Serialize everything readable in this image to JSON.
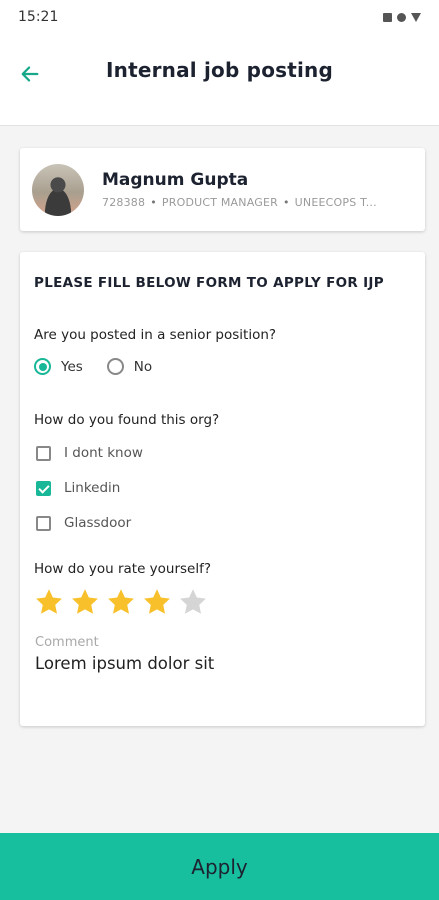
{
  "status_bar": {
    "time": "15:21"
  },
  "header": {
    "title": "Internal job posting",
    "back_icon": "arrow-left-icon"
  },
  "profile": {
    "name": "Magnum Gupta",
    "employee_id": "728388",
    "role": "PRODUCT MANAGER",
    "company": "UNEECOPS T..."
  },
  "form": {
    "heading": "PLEASE FILL BELOW FORM TO APPLY FOR IJP",
    "q1": {
      "question": "Are you posted in a senior position?",
      "options": [
        {
          "label": "Yes",
          "selected": true
        },
        {
          "label": "No",
          "selected": false
        }
      ]
    },
    "q2": {
      "question": "How do you found this org?",
      "options": [
        {
          "label": "I dont know",
          "checked": false
        },
        {
          "label": "Linkedin",
          "checked": true
        },
        {
          "label": "Glassdoor",
          "checked": false
        }
      ]
    },
    "q3": {
      "question": "How do you rate yourself?",
      "rating": 4,
      "max": 5
    },
    "comment": {
      "label": "Comment",
      "value": "Lorem ipsum dolor sit"
    }
  },
  "apply_label": "Apply",
  "colors": {
    "accent": "#17bf9f",
    "star_on": "#f8c12c",
    "star_off": "#d5d5d5"
  }
}
